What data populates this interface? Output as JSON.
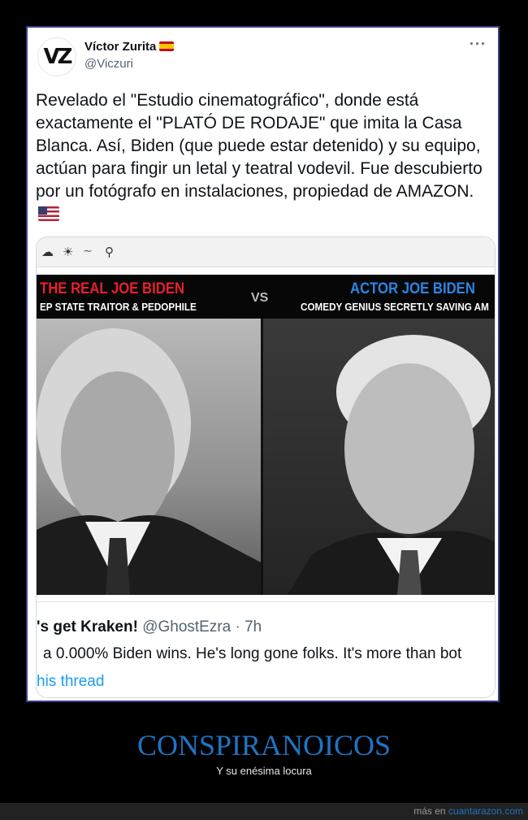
{
  "tweet": {
    "author_name": "Víctor Zurita",
    "handle": "@Viczuri",
    "avatar_text": "VZ",
    "more_label": "···",
    "text": "Revelado el \"Estudio cinematográfico\", donde está exactamente el \"PLATÓ DE RODAJE\" que imita la Casa Blanca. Así, Biden (que puede estar detenido) y su equipo, actúan para fingir un letal y teatral vodevil. Fue descubierto por un fotógrafo en instalaciones, propiedad de AMAZON."
  },
  "embedded_image": {
    "left_title": "THE REAL JOE BIDEN",
    "left_subtitle": "EP STATE TRAITOR & PEDOPHILE",
    "vs": "VS",
    "right_title": "ACTOR JOE BIDEN",
    "right_subtitle": "COMEDY GENIUS SECRETLY SAVING AM"
  },
  "quoted_tweet": {
    "name": "'s get Kraken!",
    "handle_time": "@GhostEzra · 7h",
    "text": "a 0.000% Biden wins. He's long gone folks. It's more than bot",
    "link": "his thread"
  },
  "caption": {
    "title": "CONSPIRANOICOS",
    "subtitle": "Y su enésima locura"
  },
  "footer": {
    "prefix": "más en",
    "site": "cuantarazon.com"
  },
  "colors": {
    "frame_border": "#3a3f8f",
    "caption": "#1f74c3",
    "link": "#1d9bf0",
    "left_title": "#e8202a",
    "right_title": "#2a86e6"
  }
}
